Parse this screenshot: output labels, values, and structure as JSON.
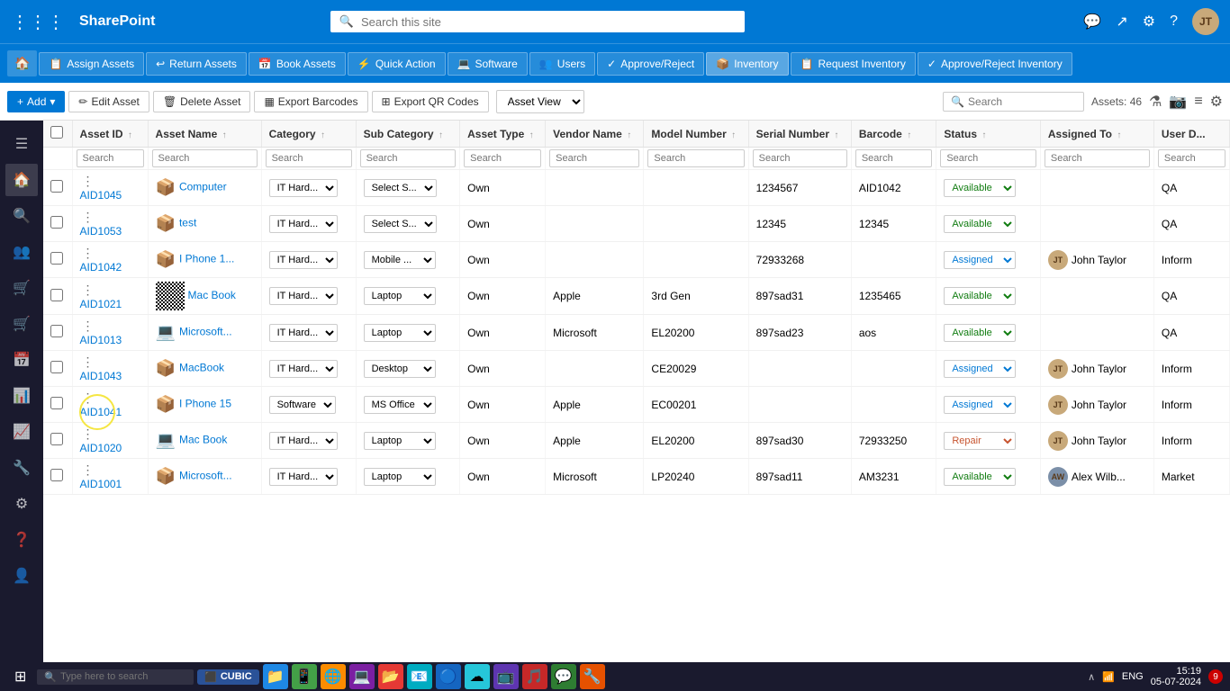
{
  "topbar": {
    "logo": "SharePoint",
    "search_placeholder": "Search this site"
  },
  "ribbon": {
    "home_icon": "🏠",
    "buttons": [
      {
        "label": "Assign Assets",
        "icon": "📋"
      },
      {
        "label": "Return Assets",
        "icon": "↩"
      },
      {
        "label": "Book Assets",
        "icon": "📅"
      },
      {
        "label": "Quick Action",
        "icon": "⚡"
      },
      {
        "label": "Software",
        "icon": "💻"
      },
      {
        "label": "Users",
        "icon": "👥"
      },
      {
        "label": "Approve/Reject",
        "icon": "✓"
      },
      {
        "label": "Inventory",
        "icon": "📦",
        "active": true
      },
      {
        "label": "Request Inventory",
        "icon": "📋"
      },
      {
        "label": "Approve/Reject Inventory",
        "icon": "✓"
      }
    ]
  },
  "toolbar": {
    "add_label": "Add",
    "edit_label": "Edit Asset",
    "delete_label": "Delete Asset",
    "export_barcodes_label": "Export Barcodes",
    "export_qr_label": "Export QR Codes",
    "asset_view_label": "Asset View",
    "search_placeholder": "Search",
    "assets_count": "Assets: 46",
    "filter_icon": "filter",
    "camera_icon": "camera",
    "columns_icon": "columns",
    "settings_icon": "settings"
  },
  "table": {
    "columns": [
      {
        "id": "checkbox",
        "label": ""
      },
      {
        "id": "assetid",
        "label": "Asset ID"
      },
      {
        "id": "assetname",
        "label": "Asset Name"
      },
      {
        "id": "category",
        "label": "Category"
      },
      {
        "id": "subcategory",
        "label": "Sub Category"
      },
      {
        "id": "assettype",
        "label": "Asset Type"
      },
      {
        "id": "vendorname",
        "label": "Vendor Name"
      },
      {
        "id": "modelnumber",
        "label": "Model Number"
      },
      {
        "id": "serialnumber",
        "label": "Serial Number"
      },
      {
        "id": "barcode",
        "label": "Barcode"
      },
      {
        "id": "status",
        "label": "Status"
      },
      {
        "id": "assignedto",
        "label": "Assigned To"
      },
      {
        "id": "userdept",
        "label": "User D..."
      }
    ],
    "search_placeholders": [
      "",
      "Search",
      "Search",
      "Search",
      "Search",
      "Search",
      "Search",
      "Search",
      "Search",
      "Search",
      "Search",
      "Search",
      "Search"
    ],
    "rows": [
      {
        "id": "AID1045",
        "name": "Computer",
        "icon": "📦",
        "category": "IT Hard...",
        "subcategory": "Select S...",
        "assettype": "Own",
        "vendor": "",
        "model": "",
        "serial": "1234567",
        "barcode": "AID1042",
        "status": "Available",
        "assignedto": "",
        "dept": "QA",
        "hasAvatar": false
      },
      {
        "id": "AID1053",
        "name": "test",
        "icon": "📦",
        "category": "IT Hard...",
        "subcategory": "Select S...",
        "assettype": "Own",
        "vendor": "",
        "model": "",
        "serial": "12345",
        "barcode": "12345",
        "status": "Available",
        "assignedto": "",
        "dept": "QA",
        "hasAvatar": false
      },
      {
        "id": "AID1042",
        "name": "I Phone 1...",
        "icon": "📦",
        "category": "IT Hard...",
        "subcategory": "Mobile ...",
        "assettype": "Own",
        "vendor": "",
        "model": "",
        "serial": "72933268",
        "barcode": "",
        "status": "Assigned",
        "assignedto": "John Taylor",
        "dept": "Inform",
        "hasAvatar": true
      },
      {
        "id": "AID1021",
        "name": "Mac Book",
        "icon": "qr",
        "category": "IT Hard...",
        "subcategory": "Laptop",
        "assettype": "Own",
        "vendor": "Apple",
        "model": "3rd Gen",
        "serial": "897sad31",
        "barcode": "1235465",
        "status": "Available",
        "assignedto": "",
        "dept": "QA",
        "hasAvatar": false
      },
      {
        "id": "AID1013",
        "name": "Microsoft...",
        "icon": "💻",
        "category": "IT Hard...",
        "subcategory": "Laptop",
        "assettype": "Own",
        "vendor": "Microsoft",
        "model": "EL20200",
        "serial": "897sad23",
        "barcode": "aos",
        "status": "Available",
        "assignedto": "",
        "dept": "QA",
        "hasAvatar": false
      },
      {
        "id": "AID1043",
        "name": "MacBook",
        "icon": "📦",
        "category": "IT Hard...",
        "subcategory": "Desktop",
        "assettype": "Own",
        "vendor": "",
        "model": "CE20029",
        "serial": "",
        "barcode": "",
        "status": "Assigned",
        "assignedto": "John Taylor",
        "dept": "Inform",
        "hasAvatar": true
      },
      {
        "id": "AID1041",
        "name": "I Phone 15",
        "icon": "📦",
        "category": "Software",
        "subcategory": "MS Office",
        "assettype": "Own",
        "vendor": "Apple",
        "model": "EC00201",
        "serial": "",
        "barcode": "",
        "status": "Assigned",
        "assignedto": "John Taylor",
        "dept": "Inform",
        "hasAvatar": true,
        "highlighted": true
      },
      {
        "id": "AID1020",
        "name": "Mac Book",
        "icon": "laptop",
        "category": "IT Hard...",
        "subcategory": "Laptop",
        "assettype": "Own",
        "vendor": "Apple",
        "model": "EL20200",
        "serial": "897sad30",
        "barcode": "72933250",
        "status": "Repair",
        "assignedto": "John Taylor",
        "dept": "Inform",
        "hasAvatar": true
      },
      {
        "id": "AID1001",
        "name": "Microsoft...",
        "icon": "📦",
        "category": "IT Hard...",
        "subcategory": "Laptop",
        "assettype": "Own",
        "vendor": "Microsoft",
        "model": "LP20240",
        "serial": "897sad11",
        "barcode": "AM3231",
        "status": "Available",
        "assignedto": "Alex Wilb...",
        "dept": "Market",
        "hasAvatar": true
      }
    ]
  },
  "sidebar": {
    "icons": [
      "☰",
      "🏠",
      "🔍",
      "👥",
      "🛒",
      "🛒",
      "📅",
      "📊",
      "📈",
      "🔧",
      "⚙",
      "❓",
      "👤"
    ]
  },
  "taskbar": {
    "start_icon": "⊞",
    "search_placeholder": "Type here to search",
    "cubic_label": "CUBIC",
    "time": "15:19",
    "date": "05-07-2024",
    "lang": "ENG",
    "notification_count": "9",
    "apps": [
      "📁",
      "📱",
      "🌐",
      "💻",
      "📂",
      "📧",
      "🔵",
      "☁",
      "📺",
      "🎵",
      "💬",
      "🔧"
    ]
  }
}
